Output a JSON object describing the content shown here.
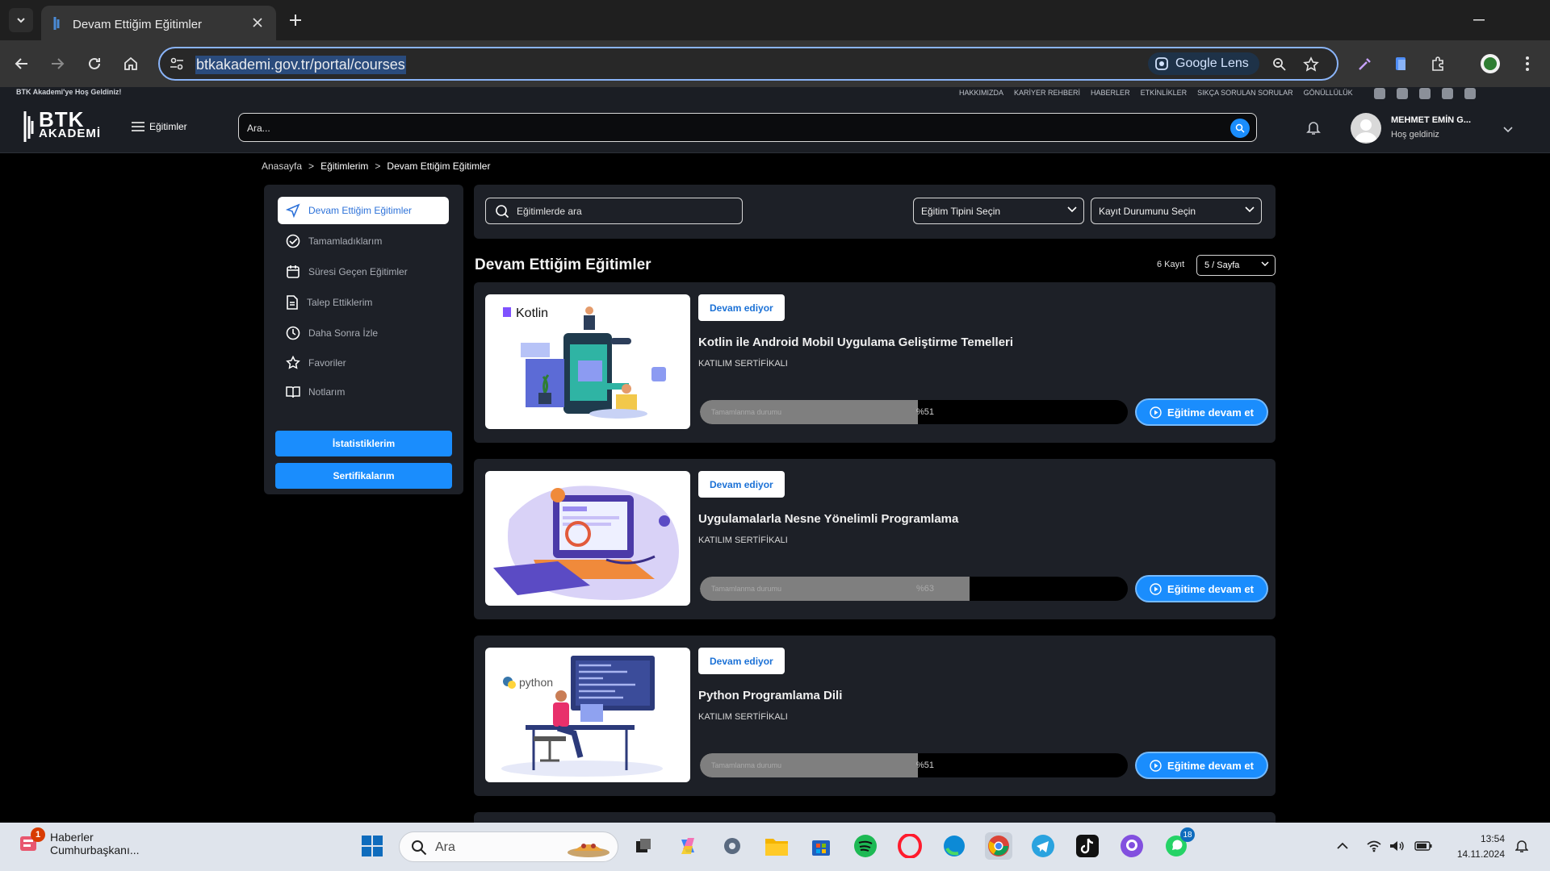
{
  "browser": {
    "tab_title": "Devam Ettiğim Eğitimler",
    "url": "btkakademi.gov.tr/portal/courses",
    "lens_label": "Google Lens"
  },
  "site": {
    "welcome": "BTK Akademi'ye Hoş Geldiniz!",
    "top_links": [
      "HAKKIMIZDA",
      "KARİYER REHBERİ",
      "HABERLER",
      "ETKİNLİKLER",
      "SIKÇA SORULAN SORULAR",
      "GÖNÜLLÜLÜK"
    ],
    "logo_line1": "BTK",
    "logo_line2": "AKADEMİ",
    "menu_label": "Eğitimler",
    "search_placeholder": "Ara...",
    "user_name": "MEHMET EMİN G...",
    "user_greeting": "Hoş geldiniz"
  },
  "breadcrumb": [
    "Anasayfa",
    ">",
    "Eğitimlerim",
    ">",
    "Devam Ettiğim Eğitimler"
  ],
  "sidebar": {
    "items": [
      {
        "label": "Devam Ettiğim Eğitimler",
        "icon": "send-icon",
        "active": true
      },
      {
        "label": "Tamamladıklarım",
        "icon": "check-circle-icon"
      },
      {
        "label": "Süresi Geçen Eğitimler",
        "icon": "calendar-icon"
      },
      {
        "label": "Talep Ettiklerim",
        "icon": "document-icon"
      },
      {
        "label": "Daha Sonra İzle",
        "icon": "clock-icon"
      },
      {
        "label": "Favoriler",
        "icon": "star-icon"
      },
      {
        "label": "Notlarım",
        "icon": "book-icon"
      }
    ],
    "stats_button": "İstatistiklerim",
    "certs_button": "Sertifikalarım"
  },
  "filters": {
    "search_placeholder": "Eğitimlerde ara",
    "type_select": "Eğitim Tipini Seçin",
    "status_select": "Kayıt Durumunu Seçin"
  },
  "section": {
    "title": "Devam Ettiğim Eğitimler",
    "count": "6 Kayıt",
    "page_size": "5 / Sayfa"
  },
  "courses": [
    {
      "status": "Devam ediyor",
      "title": "Kotlin ile Android Mobil Uygulama Geliştirme Temelleri",
      "subtitle": "KATILIM SERTİFİKALI",
      "progress_label": "Tamamlanma durumu",
      "progress_text": "%51",
      "progress": 51,
      "thumb_label": "Kotlin",
      "button": "Eğitime devam et"
    },
    {
      "status": "Devam ediyor",
      "title": "Uygulamalarla Nesne Yönelimli Programlama",
      "subtitle": "KATILIM SERTİFİKALI",
      "progress_label": "Tamamlanma durumu",
      "progress_text": "%63",
      "progress": 63,
      "thumb_label": "",
      "button": "Eğitime devam et"
    },
    {
      "status": "Devam ediyor",
      "title": "Python Programlama Dili",
      "subtitle": "KATILIM SERTİFİKALI",
      "progress_label": "Tamamlanma durumu",
      "progress_text": "%51",
      "progress": 51,
      "thumb_label": "python",
      "button": "Eğitime devam et"
    }
  ],
  "taskbar": {
    "news_title": "Haberler",
    "news_sub": "Cumhurbaşkanı...",
    "news_badge": "1",
    "search_placeholder": "Ara",
    "whatsapp_badge": "18",
    "time": "13:54",
    "date": "14.11.2024"
  },
  "colors": {
    "accent": "#1a8dfd",
    "panel": "#1d2027",
    "background": "#000000"
  }
}
